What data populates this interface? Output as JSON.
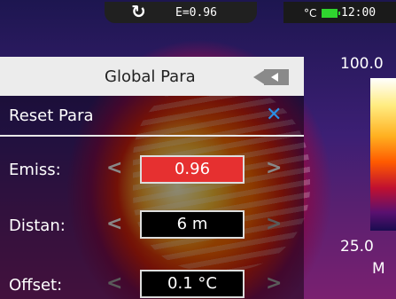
{
  "status": {
    "emissivity": "E=0.96",
    "unit": "°C",
    "time": "12:00"
  },
  "scale": {
    "max": "100.0",
    "min": "25.0",
    "mode": "M"
  },
  "panel": {
    "title": "Global Para",
    "reset_label": "Reset Para",
    "rows": [
      {
        "label": "Emiss:",
        "value": "0.96",
        "left_chevron": "<",
        "right_chevron": ">"
      },
      {
        "label": "Distan:",
        "value": "6 m",
        "left_chevron": "<",
        "right_chevron": ">"
      },
      {
        "label": "Offset:",
        "value": "0.1 °C",
        "left_chevron": "<",
        "right_chevron": ">"
      }
    ]
  },
  "colors": {
    "accent_blue": "#2a8fe6",
    "selected_value": "#e63030",
    "battery_green": "#2fd42f"
  },
  "icons": [
    "refresh-icon",
    "battery-icon",
    "back-arrow-icon",
    "close-icon",
    "chevron-left-icon",
    "chevron-right-icon"
  ]
}
